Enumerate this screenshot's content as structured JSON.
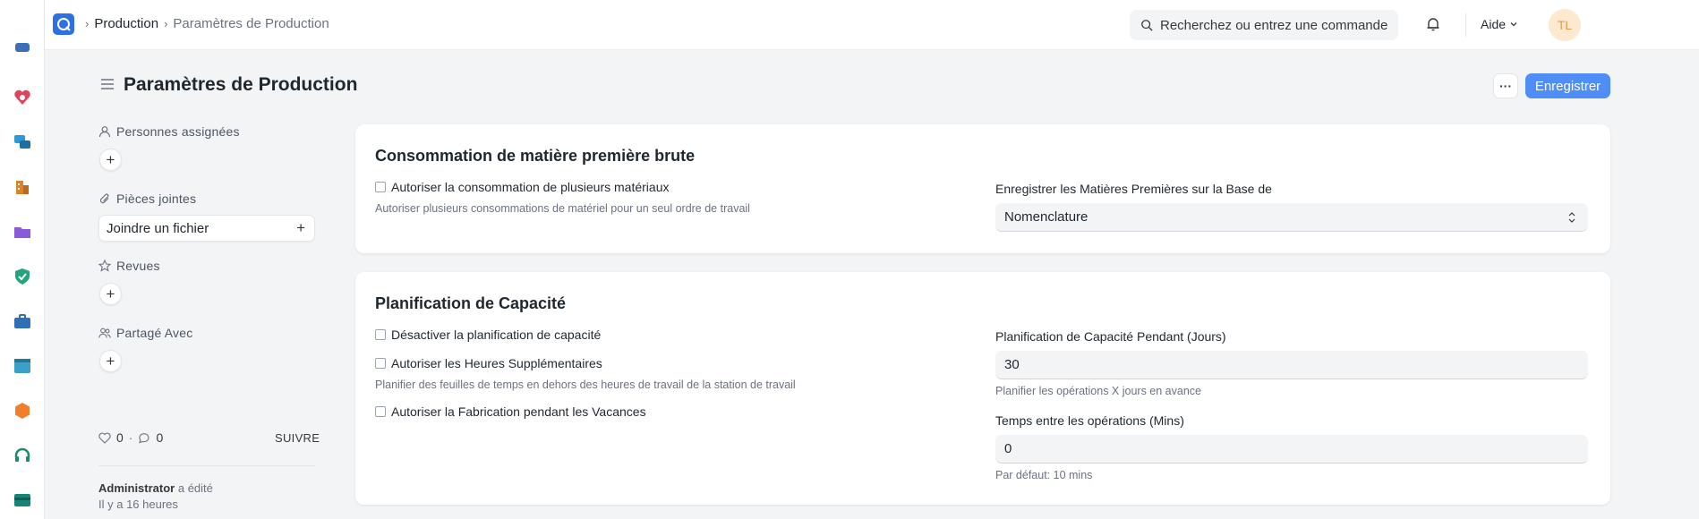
{
  "navbar": {
    "breadcrumbs": [
      "Production",
      "Paramètres de Production"
    ],
    "search_placeholder": "Recherchez ou entrez une commande",
    "help_label": "Aide",
    "avatar_initials": "TL"
  },
  "page": {
    "title": "Paramètres de Production",
    "more_label": "···",
    "save_label": "Enregistrer"
  },
  "sidebar": {
    "assigned_label": "Personnes assignées",
    "attachments_label": "Pièces jointes",
    "attach_button": "Joindre un fichier",
    "reviews_label": "Revues",
    "shared_label": "Partagé Avec",
    "likes": "0",
    "comments": "0",
    "separator": "·",
    "follow_label": "SUIVRE",
    "activity_user": "Administrator",
    "activity_action": "a édité",
    "activity_time": "Il y a 16 heures"
  },
  "section_consumption": {
    "title": "Consommation de matière première brute",
    "multi_material_label": "Autoriser la consommation de plusieurs matériaux",
    "multi_material_desc": "Autoriser plusieurs consommations de matériel pour un seul ordre de travail",
    "backflush_label": "Enregistrer les Matières Premières sur la Base de",
    "backflush_value": "Nomenclature"
  },
  "section_capacity": {
    "title": "Planification de Capacité",
    "disable_capacity_label": "Désactiver la planification de capacité",
    "overtime_label": "Autoriser les Heures Supplémentaires",
    "overtime_desc": "Planifier des feuilles de temps en dehors des heures de travail de la station de travail",
    "holidays_label": "Autoriser la Fabrication pendant les Vacances",
    "capacity_days_label": "Planification de Capacité Pendant (Jours)",
    "capacity_days_value": "30",
    "capacity_days_desc": "Planifier les opérations X jours en avance",
    "time_between_label": "Temps entre les opérations (Mins)",
    "time_between_value": "0",
    "time_between_desc": "Par défaut: 10 mins"
  },
  "colors": {
    "primary": "#4f8ef7",
    "logo": "#2f6fe4",
    "avatar_bg": "#fde8d0",
    "avatar_text": "#e29b4b"
  },
  "rail_icons": [
    "box-icon",
    "heart-shield-icon",
    "chat-icon",
    "building-icon",
    "folder-icon",
    "shield-check-icon",
    "briefcase-icon",
    "window-icon",
    "hexagon-icon",
    "headset-icon",
    "card-icon"
  ]
}
